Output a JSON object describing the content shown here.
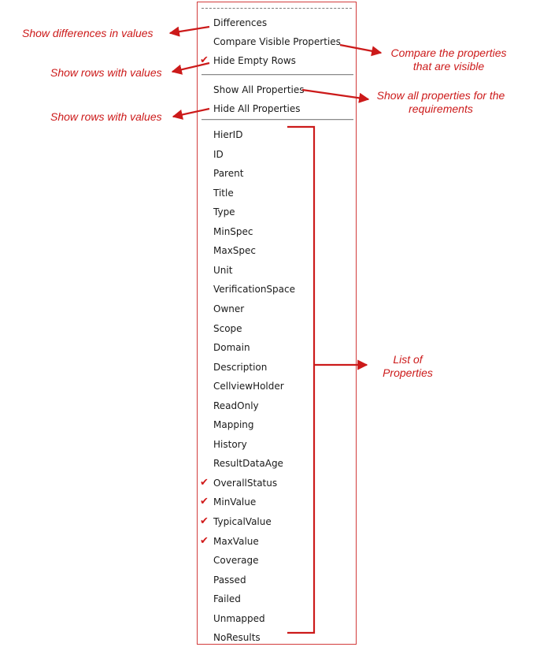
{
  "menu": {
    "top_items": [
      {
        "label": "Differences",
        "checked": false
      },
      {
        "label": "Compare Visible Properties",
        "checked": false
      },
      {
        "label": "Hide Empty Rows",
        "checked": true
      }
    ],
    "middle_items": [
      {
        "label": "Show All Properties",
        "checked": false
      },
      {
        "label": "Hide All Properties",
        "checked": false
      }
    ],
    "properties": [
      {
        "label": "HierID",
        "checked": false
      },
      {
        "label": "ID",
        "checked": false
      },
      {
        "label": "Parent",
        "checked": false
      },
      {
        "label": "Title",
        "checked": false
      },
      {
        "label": "Type",
        "checked": false
      },
      {
        "label": "MinSpec",
        "checked": false
      },
      {
        "label": "MaxSpec",
        "checked": false
      },
      {
        "label": "Unit",
        "checked": false
      },
      {
        "label": "VerificationSpace",
        "checked": false
      },
      {
        "label": "Owner",
        "checked": false
      },
      {
        "label": "Scope",
        "checked": false
      },
      {
        "label": "Domain",
        "checked": false
      },
      {
        "label": "Description",
        "checked": false
      },
      {
        "label": "CellviewHolder",
        "checked": false
      },
      {
        "label": "ReadOnly",
        "checked": false
      },
      {
        "label": "Mapping",
        "checked": false
      },
      {
        "label": "History",
        "checked": false
      },
      {
        "label": "ResultDataAge",
        "checked": false
      },
      {
        "label": "OverallStatus",
        "checked": true
      },
      {
        "label": "MinValue",
        "checked": true
      },
      {
        "label": "TypicalValue",
        "checked": true
      },
      {
        "label": "MaxValue",
        "checked": true
      },
      {
        "label": "Coverage",
        "checked": false
      },
      {
        "label": "Passed",
        "checked": false
      },
      {
        "label": "Failed",
        "checked": false
      },
      {
        "label": "Unmapped",
        "checked": false
      },
      {
        "label": "NoResults",
        "checked": false
      }
    ]
  },
  "annotations": {
    "differences": "Show differences in values",
    "compare_line1": "Compare the properties",
    "compare_line2": "that are visible",
    "hide_empty": "Show rows with values",
    "show_all_line1": "Show all properties for the",
    "show_all_line2": "requirements",
    "hide_all": "Show rows with values",
    "list_line1": "List of",
    "list_line2": "Properties"
  },
  "colors": {
    "annotation": "#cc1a1a",
    "checkmark": "#d11a1a",
    "menu_border": "#d23b3b"
  },
  "icons": {
    "checkmark": "✔"
  }
}
